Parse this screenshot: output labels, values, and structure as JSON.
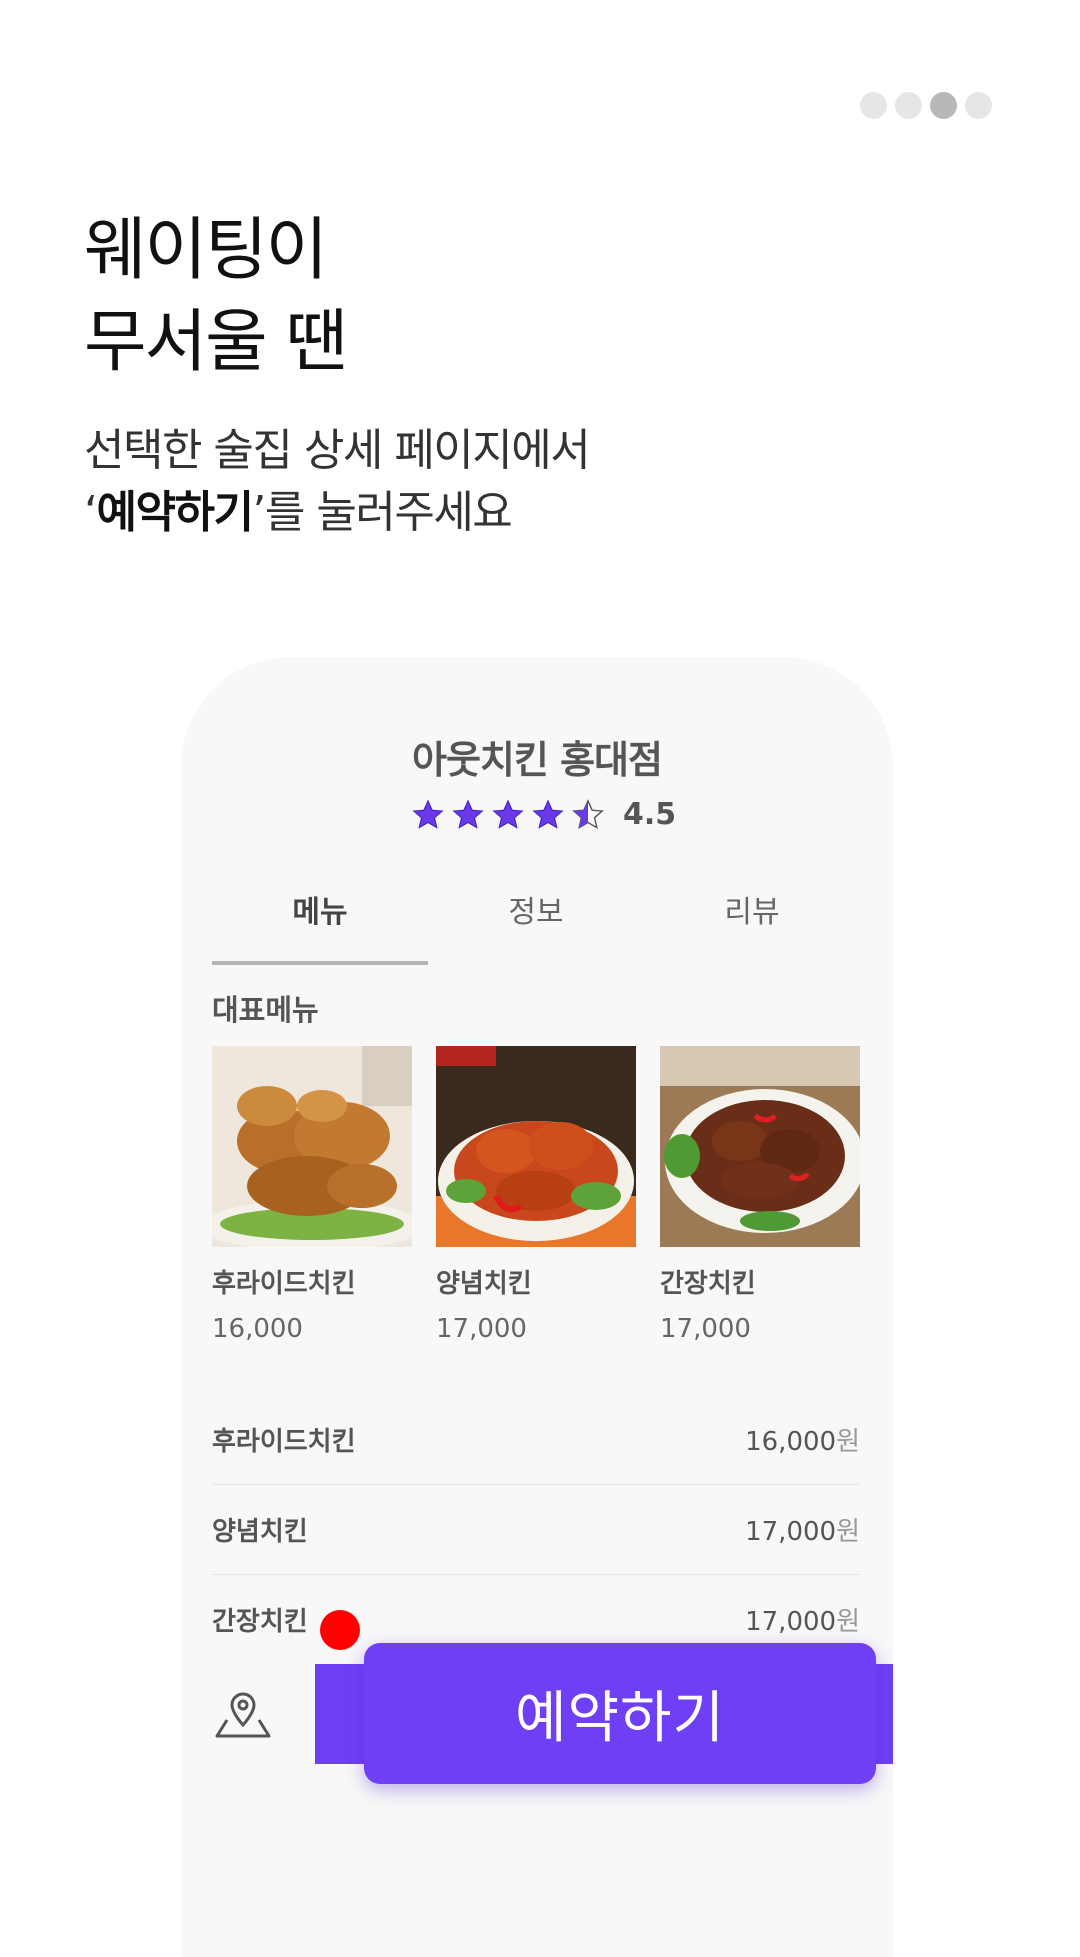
{
  "pager": {
    "count": 4,
    "active": 3
  },
  "headline": {
    "line1": "웨이팅이",
    "line2": "무서울 땐"
  },
  "subtext": {
    "line1": "선택한 술집 상세 페이지에서",
    "quote_open": "‘",
    "bold": "예약하기",
    "quote_close": "’",
    "rest": "를 눌러주세요"
  },
  "store": {
    "name": "아웃치킨 홍대점",
    "rating": 4.5,
    "rating_text": "4.5"
  },
  "colors": {
    "accent": "#6e3ff5",
    "star": "#6a3ae8"
  },
  "tabs": [
    {
      "label": "메뉴",
      "active": true
    },
    {
      "label": "정보",
      "active": false
    },
    {
      "label": "리뷰",
      "active": false
    }
  ],
  "featured": {
    "title": "대표메뉴",
    "items": [
      {
        "name": "후라이드치킨",
        "price": "16,000"
      },
      {
        "name": "양념치킨",
        "price": "17,000"
      },
      {
        "name": "간장치킨",
        "price": "17,000"
      }
    ]
  },
  "menu": [
    {
      "name": "후라이드치킨",
      "price": "16,000",
      "unit": "원"
    },
    {
      "name": "양념치킨",
      "price": "17,000",
      "unit": "원"
    },
    {
      "name": "간장치킨",
      "price": "17,000",
      "unit": "원"
    }
  ],
  "icons": {
    "location": "location-pin-icon",
    "star": "star-icon"
  },
  "cta": {
    "label": "예약하기"
  }
}
